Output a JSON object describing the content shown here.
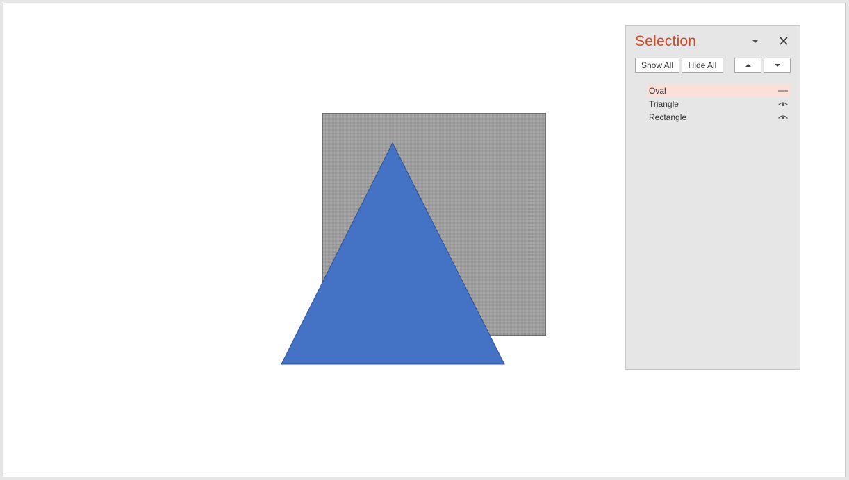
{
  "selection_pane": {
    "title": "Selection",
    "show_all_label": "Show All",
    "hide_all_label": "Hide All",
    "bring_forward_icon": "triangle-up-icon",
    "send_backward_icon": "triangle-down-icon",
    "dropdown_icon": "chevron-down-icon",
    "close_icon": "close-icon",
    "items": [
      {
        "label": "Oval",
        "visibility": "hidden",
        "visibility_icon": "dash-icon",
        "selected": true
      },
      {
        "label": "Triangle",
        "visibility": "visible",
        "visibility_icon": "eye-icon",
        "selected": false
      },
      {
        "label": "Rectangle",
        "visibility": "visible",
        "visibility_icon": "eye-icon",
        "selected": false
      }
    ]
  },
  "slide_shapes": [
    {
      "name": "Rectangle",
      "fill": "#a2a2a2",
      "pattern": "dotted-texture"
    },
    {
      "name": "Triangle",
      "fill": "#4472c4",
      "outline": "#2f528f"
    }
  ],
  "colors": {
    "accent_title": "#d24726",
    "selected_row": "#fbe0da",
    "pane_background": "#e6e6e6",
    "canvas_background": "#ffffff"
  }
}
